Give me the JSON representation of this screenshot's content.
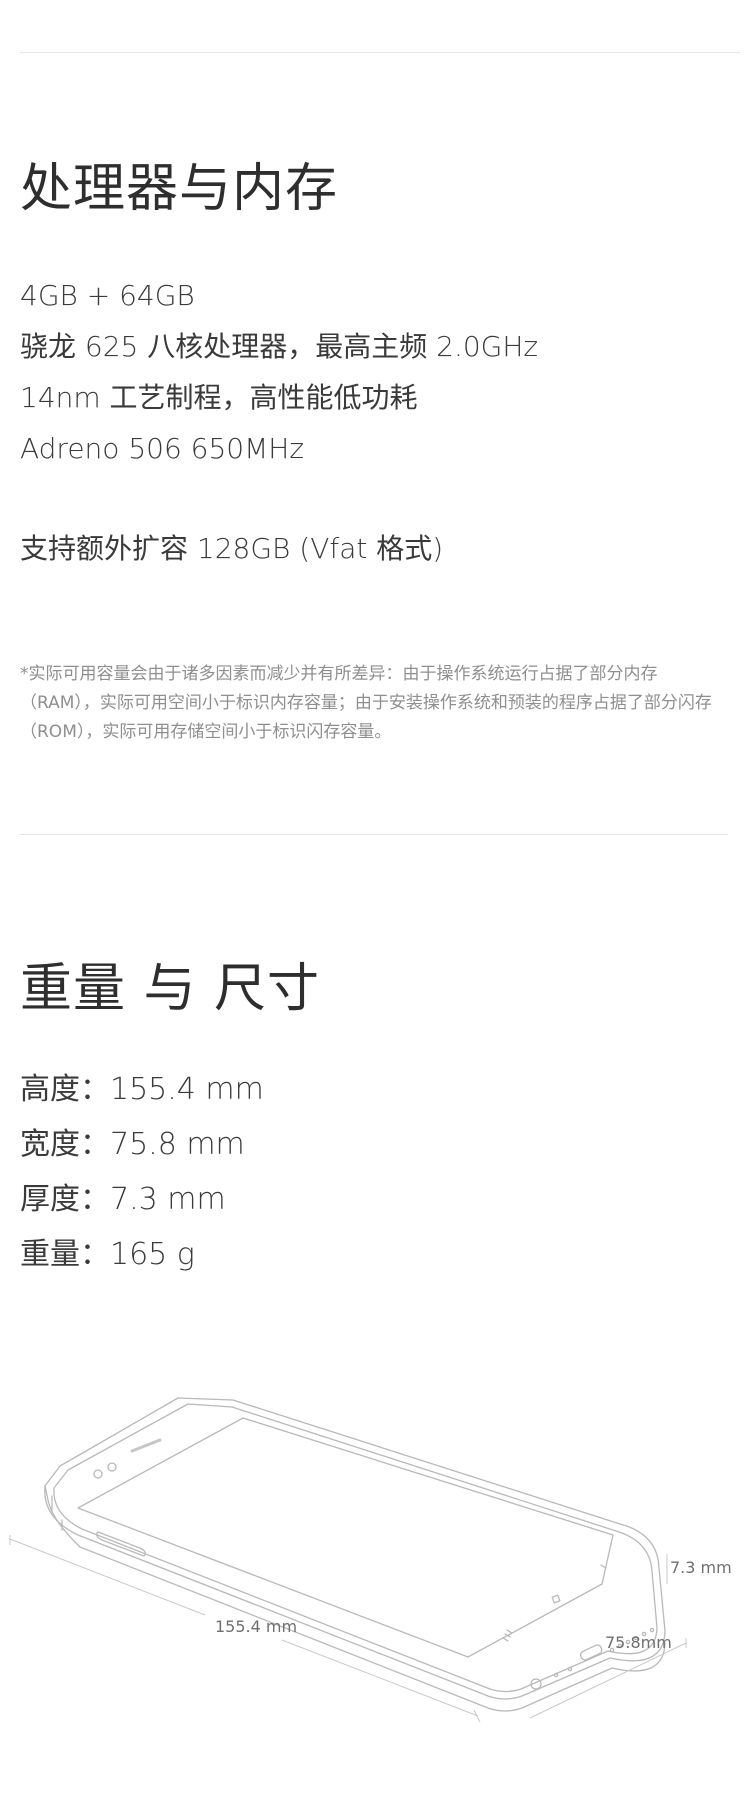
{
  "processor_section": {
    "title": "处理器与内存",
    "specs": [
      "4GB + 64GB",
      "骁龙 625 八核处理器，最高主频 2.0GHz",
      "14nm 工艺制程，高性能低功耗",
      "Adreno 506 650MHz"
    ],
    "storage_expansion": "支持额外扩容 128GB (Vfat 格式)",
    "footnote": "*实际可用容量会由于诸多因素而减少并有所差异：由于操作系统运行占据了部分内存（RAM），实际可用空间小于标识内存容量；由于安装操作系统和预装的程序占据了部分闪存（ROM），实际可用存储空间小于标识闪存容量。"
  },
  "dimensions_section": {
    "title": "重量 与 尺寸",
    "specs": [
      "高度：155.4 mm",
      "宽度：75.8 mm",
      "厚度：7.3  mm",
      "重量：165 g"
    ],
    "diagram_labels": {
      "length": "155.4 mm",
      "width": "75.8mm",
      "thickness": "7.3 mm"
    }
  }
}
